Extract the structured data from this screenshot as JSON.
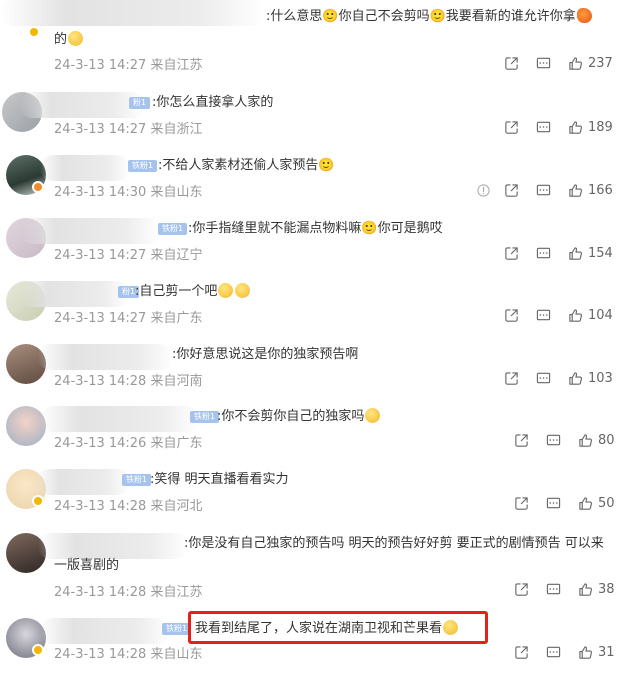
{
  "comments": [
    {
      "text": ":什么意思🙂你自己不会剪吗🙂我要看新的谁允许你拿",
      "text_cont": "的",
      "date": "24-3-13 14:27",
      "location": "来自江苏",
      "likes": "237",
      "badge": ""
    },
    {
      "text": ":你怎么直接拿人家的",
      "date": "24-3-13 14:27",
      "location": "来自浙江",
      "likes": "189",
      "badge": "粉1"
    },
    {
      "text": ":不给人家素材还偷人家预告🙂",
      "date": "24-3-13 14:30",
      "location": "来自山东",
      "likes": "166",
      "badge": "铁粉1"
    },
    {
      "text": ":你手指缝里就不能漏点物料嘛🙂你可是鹅哎",
      "date": "24-3-13 14:27",
      "location": "来自辽宁",
      "likes": "154",
      "badge": "铁粉1"
    },
    {
      "text": ":自己剪一个吧",
      "date": "24-3-13 14:27",
      "location": "来自广东",
      "likes": "104",
      "badge": "粉1"
    },
    {
      "text": ":你好意思说这是你的独家预告啊",
      "date": "24-3-13 14:28",
      "location": "来自河南",
      "likes": "103",
      "badge": ""
    },
    {
      "text": ":你不会剪你自己的独家吗",
      "date": "24-3-13 14:26",
      "location": "来自广东",
      "likes": "80",
      "badge": "铁粉1"
    },
    {
      "text": ":笑得 明天直播看看实力",
      "date": "24-3-13 14:28",
      "location": "来自河北",
      "likes": "50",
      "badge": "铁粉1"
    },
    {
      "text": ":你是没有自己独家的预告吗 明天的预告好好剪 要正式的剧情预告 可以来",
      "text_cont": "一版喜剧的",
      "date": "24-3-13 14:28",
      "location": "来自江苏",
      "likes": "38",
      "badge": ""
    },
    {
      "text": "我看到结尾了，人家说在湖南卫视和芒果看",
      "date": "24-3-13 14:28",
      "location": "来自山东",
      "likes": "31",
      "badge": "铁粉1"
    }
  ],
  "colors": {
    "meta": "#999999",
    "text": "#333333",
    "highlight": "#e2231a",
    "fan_badge": "#a6c3ee"
  }
}
